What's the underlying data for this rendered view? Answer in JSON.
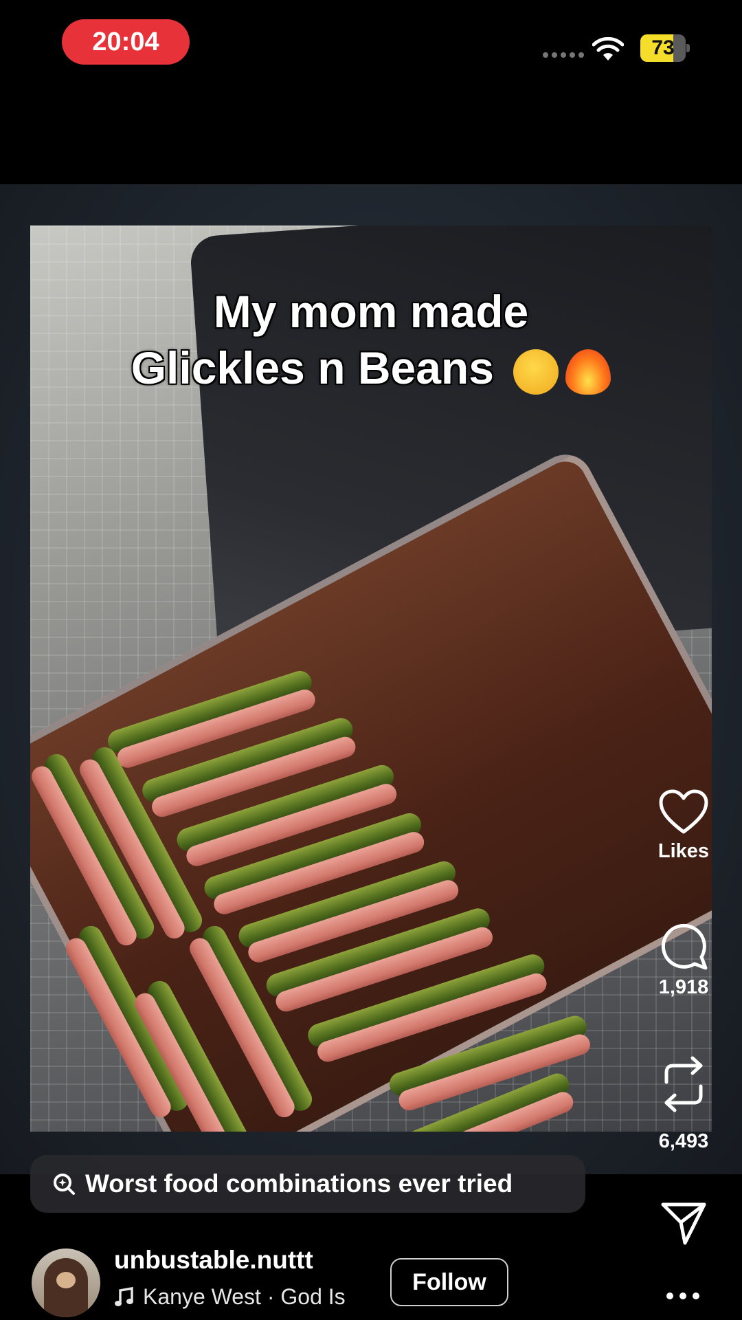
{
  "status_bar": {
    "time": "20:04",
    "battery_level": "73",
    "battery_fraction": 0.73,
    "colors": {
      "time_pill": "#e8323a",
      "battery": "#f5dd2b"
    }
  },
  "post": {
    "caption_line1": "My mom made",
    "caption_line2": "Glickles n Beans",
    "caption_emojis": [
      "drooling-face",
      "fire"
    ]
  },
  "actions": {
    "likes_label": "Likes",
    "comments_count": "1,918",
    "reposts_count": "6,493"
  },
  "search": {
    "label": "Worst food combinations ever tried"
  },
  "author": {
    "username": "unbustable.nuttt",
    "music": "Kanye West · God Is",
    "follow_label": "Follow"
  },
  "icons": [
    "wifi-icon",
    "heart-icon",
    "comment-icon",
    "repost-icon",
    "send-icon",
    "search-sparkle-icon",
    "music-note-icon",
    "more-icon"
  ]
}
